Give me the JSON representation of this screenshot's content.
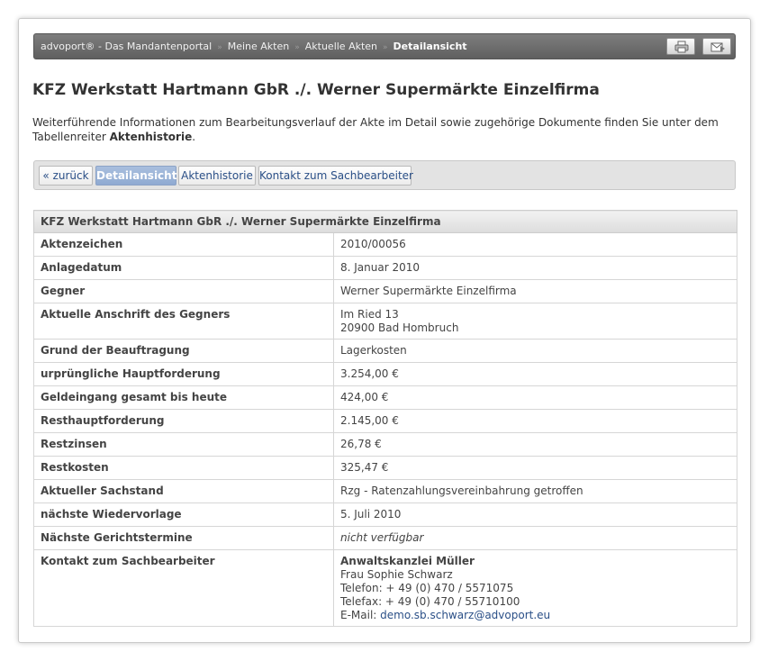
{
  "breadcrumb": {
    "items": [
      "advoport® - Das Mandantenportal",
      "Meine Akten",
      "Aktuelle Akten"
    ],
    "current": "Detailansicht",
    "separator": "»"
  },
  "toolbar": {
    "print_icon": "printer-icon",
    "mail_icon": "mail-forward-icon"
  },
  "page": {
    "title": "KFZ Werkstatt Hartmann GbR ./. Werner Supermärkte Einzelfirma",
    "intro_text": "Weiterführende Informationen zum Bearbeitungsverlauf der Akte im Detail sowie zugehörige Dokumente finden Sie unter dem Tabellenreiter ",
    "intro_bold": "Aktenhistorie",
    "intro_end": "."
  },
  "tabs": [
    {
      "label": "« zurück",
      "active": false
    },
    {
      "label": "Detailansicht",
      "active": true
    },
    {
      "label": "Aktenhistorie",
      "active": false
    },
    {
      "label": "Kontakt zum Sachbearbeiter",
      "active": false
    }
  ],
  "table": {
    "header": "KFZ Werkstatt Hartmann GbR ./. Werner Supermärkte Einzelfirma",
    "rows": [
      {
        "label": "Aktenzeichen",
        "value": "2010/00056"
      },
      {
        "label": "Anlagedatum",
        "value": "8. Januar 2010"
      },
      {
        "label": "Gegner",
        "value": "Werner Supermärkte Einzelfirma"
      },
      {
        "label": "Aktuelle Anschrift des Gegners",
        "value": "Im Ried 13",
        "value2": "20900 Bad Hombruch"
      },
      {
        "label": "Grund der Beauftragung",
        "value": "Lagerkosten"
      },
      {
        "label": "urprüngliche Hauptforderung",
        "value": "3.254,00 €"
      },
      {
        "label": "Geldeingang gesamt bis heute",
        "value": "424,00 €"
      },
      {
        "label": "Resthauptforderung",
        "value": "2.145,00 €"
      },
      {
        "label": "Restzinsen",
        "value": "26,78 €"
      },
      {
        "label": "Restkosten",
        "value": "325,47 €"
      },
      {
        "label": "Aktueller Sachstand",
        "value": "Rzg - Ratenzahlungsvereinbahrung getroffen"
      },
      {
        "label": "nächste Wiedervorlage",
        "value": "5. Juli 2010"
      },
      {
        "label": "Nächste Gerichtstermine",
        "value": "nicht verfügbar"
      }
    ],
    "contact": {
      "label": "Kontakt zum Sachbearbeiter",
      "firm": "Anwaltskanzlei Müller",
      "name": "Frau Sophie Schwarz",
      "phone": "Telefon: + 49 (0) 470 / 5571075",
      "fax": "Telefax: + 49 (0) 470 / 55710100",
      "email_prefix": "E-Mail: ",
      "email": "demo.sb.schwarz@advoport.eu"
    }
  }
}
